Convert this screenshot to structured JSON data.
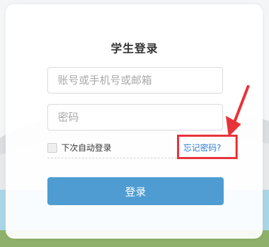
{
  "login": {
    "title": "学生登录",
    "account_placeholder": "账号或手机号或邮箱",
    "password_placeholder": "密码",
    "remember_label": "下次自动登录",
    "forgot_label": "忘记密码?",
    "submit_label": "登录"
  },
  "colors": {
    "primary_button": "#4e9cd2",
    "forgot_link": "#2e7bd6",
    "annotation_red": "#e8323a"
  }
}
